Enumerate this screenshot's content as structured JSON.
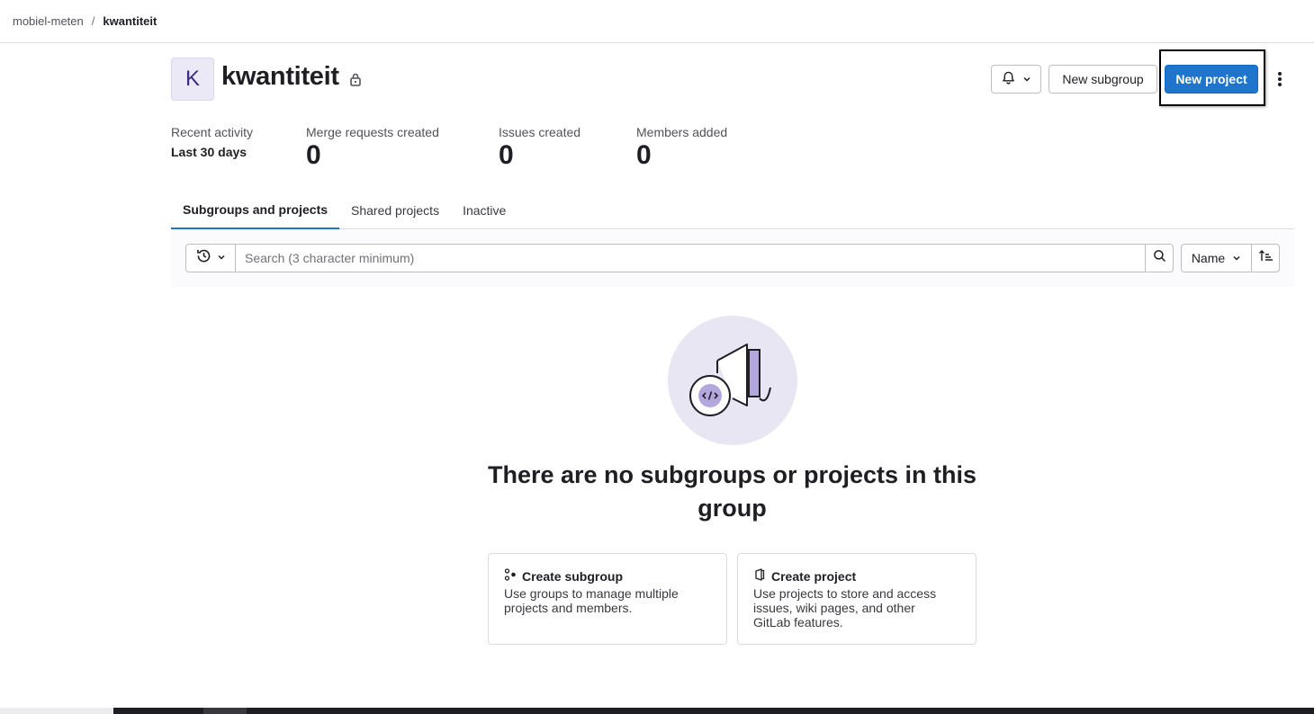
{
  "breadcrumb": {
    "parent": "mobiel-meten",
    "separator": "/",
    "current": "kwantiteit"
  },
  "group": {
    "avatar_letter": "K",
    "name": "kwantiteit",
    "visibility_icon": "lock-icon"
  },
  "header_actions": {
    "notifications_icon": "bell-icon",
    "new_subgroup": "New subgroup",
    "new_project": "New project",
    "more_icon": "ellipsis-v-icon"
  },
  "stats": {
    "activity_label": "Recent activity",
    "activity_period": "Last 30 days",
    "items": [
      {
        "label": "Merge requests created",
        "value": "0"
      },
      {
        "label": "Issues created",
        "value": "0"
      },
      {
        "label": "Members added",
        "value": "0"
      }
    ]
  },
  "tabs": [
    {
      "label": "Subgroups and projects",
      "active": true
    },
    {
      "label": "Shared projects",
      "active": false
    },
    {
      "label": "Inactive",
      "active": false
    }
  ],
  "filter": {
    "search_placeholder": "Search (3 character minimum)",
    "search_value": "",
    "sort_value": "Name",
    "history_icon": "history-icon",
    "search_icon": "search-icon",
    "sort_direction_icon": "sort-ascending-icon"
  },
  "empty_state": {
    "title": "There are no subgroups or projects in this group",
    "cards": [
      {
        "icon": "subgroup-icon",
        "title": "Create subgroup",
        "description": "Use groups to manage multiple projects and members."
      },
      {
        "icon": "project-icon",
        "title": "Create project",
        "description": "Use projects to store and access issues, wiki pages, and other GitLab features."
      }
    ]
  },
  "colors": {
    "primary": "#1f75cb",
    "avatar_bg": "#ece9f7",
    "illustration_bg": "#e8e6f2",
    "text": "#1f1e24"
  }
}
